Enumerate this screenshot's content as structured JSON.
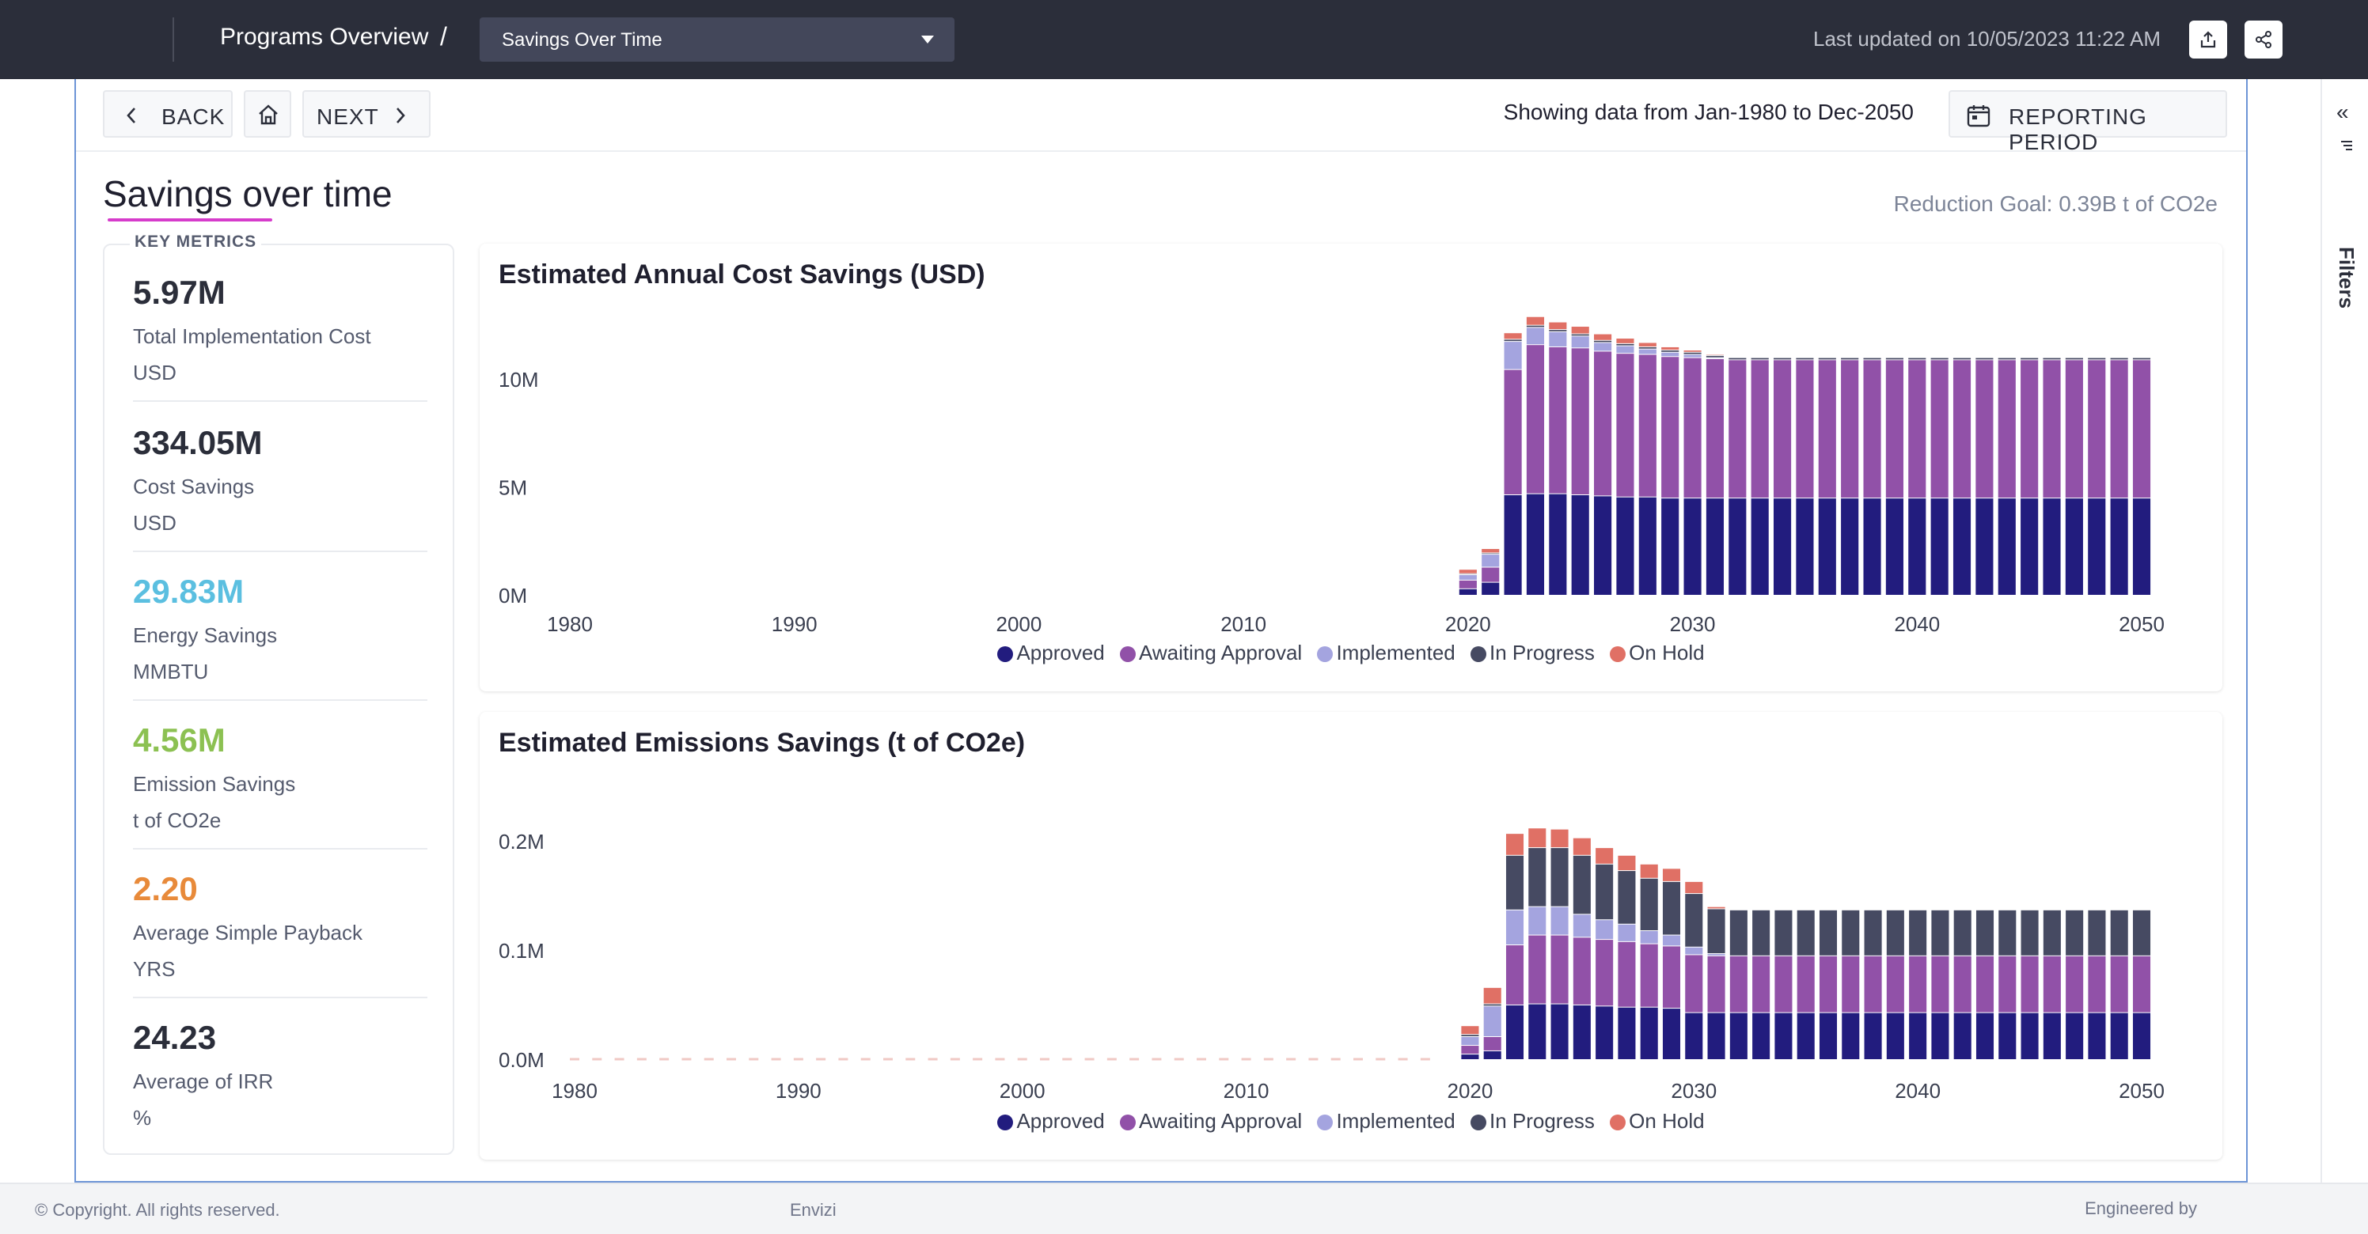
{
  "header": {
    "breadcrumb": "Programs Overview",
    "separator": "/",
    "view_select": "Savings Over Time",
    "last_updated": "Last updated on 10/05/2023 11:22 AM",
    "icons": [
      "export-icon",
      "share-icon"
    ]
  },
  "nav": {
    "back_label": "BACK",
    "next_label": "NEXT",
    "showing_text": "Showing data from Jan-1980 to Dec-2050",
    "reporting_period_label": "REPORTING PERIOD"
  },
  "page": {
    "title": "Savings over time",
    "reduction_goal": "Reduction Goal: 0.39B t of CO2e"
  },
  "key_metrics": {
    "heading": "KEY METRICS",
    "items": [
      {
        "value": "5.97M",
        "label": "Total Implementation Cost",
        "unit": "USD",
        "color": "#2b2e3a"
      },
      {
        "value": "334.05M",
        "label": "Cost Savings",
        "unit": "USD",
        "color": "#2b2e3a"
      },
      {
        "value": "29.83M",
        "label": "Energy Savings",
        "unit": "MMBTU",
        "color": "#5bbfe0"
      },
      {
        "value": "4.56M",
        "label": "Emission Savings",
        "unit": "t of CO2e",
        "color": "#8cc152"
      },
      {
        "value": "2.20",
        "label": "Average Simple Payback",
        "unit": "YRS",
        "color": "#e88a3a"
      },
      {
        "value": "24.23",
        "label": "Average of IRR",
        "unit": "%",
        "color": "#2b2e3a"
      }
    ]
  },
  "legend": {
    "approved": "Approved",
    "awaiting": "Awaiting Approval",
    "implemented": "Implemented",
    "in_progress": "In Progress",
    "on_hold": "On Hold"
  },
  "colors": {
    "approved": "#221c7e",
    "awaiting": "#9151a8",
    "implemented": "#a4a4df",
    "in_progress": "#464a62",
    "on_hold": "#e07065"
  },
  "chart_data": [
    {
      "type": "bar",
      "stacked": true,
      "title": "Estimated Annual Cost Savings (USD)",
      "xlabel": "",
      "ylabel": "",
      "xlim": [
        1980,
        2050
      ],
      "ylim": [
        0,
        13000000
      ],
      "x_ticks": [
        "1980",
        "1990",
        "2000",
        "2010",
        "2020",
        "2030",
        "2040",
        "2050"
      ],
      "y_ticks": [
        {
          "value": 0,
          "label": "0M"
        },
        {
          "value": 5000000,
          "label": "5M"
        },
        {
          "value": 10000000,
          "label": "10M"
        }
      ],
      "x": [
        2020,
        2021,
        2022,
        2023,
        2024,
        2025,
        2026,
        2027,
        2028,
        2029,
        2030,
        2031,
        2032,
        2033,
        2034,
        2035,
        2036,
        2037,
        2038,
        2039,
        2040,
        2041,
        2042,
        2043,
        2044,
        2045,
        2046,
        2047,
        2048,
        2049,
        2050
      ],
      "series": [
        {
          "name": "Approved",
          "values": [
            300000,
            600000,
            4650000,
            4700000,
            4700000,
            4650000,
            4600000,
            4550000,
            4550000,
            4500000,
            4500000,
            4500000,
            4500000,
            4500000,
            4500000,
            4500000,
            4500000,
            4500000,
            4500000,
            4500000,
            4500000,
            4500000,
            4500000,
            4500000,
            4500000,
            4500000,
            4500000,
            4500000,
            4500000,
            4500000,
            4500000
          ]
        },
        {
          "name": "Awaiting Approval",
          "values": [
            400000,
            700000,
            5800000,
            6900000,
            6800000,
            6800000,
            6700000,
            6650000,
            6600000,
            6550000,
            6500000,
            6450000,
            6400000,
            6400000,
            6400000,
            6400000,
            6400000,
            6400000,
            6400000,
            6400000,
            6400000,
            6400000,
            6400000,
            6400000,
            6400000,
            6400000,
            6400000,
            6400000,
            6400000,
            6400000,
            6400000
          ]
        },
        {
          "name": "Implemented",
          "values": [
            250000,
            600000,
            1300000,
            800000,
            700000,
            550000,
            400000,
            350000,
            250000,
            200000,
            150000,
            50000,
            0,
            0,
            0,
            0,
            0,
            0,
            0,
            0,
            0,
            0,
            0,
            0,
            0,
            0,
            0,
            0,
            0,
            0,
            0
          ]
        },
        {
          "name": "In Progress",
          "values": [
            50000,
            60000,
            100000,
            100000,
            100000,
            100000,
            100000,
            100000,
            100000,
            100000,
            100000,
            100000,
            100000,
            100000,
            100000,
            100000,
            100000,
            100000,
            100000,
            100000,
            100000,
            100000,
            100000,
            100000,
            100000,
            100000,
            100000,
            100000,
            100000,
            100000,
            100000
          ]
        },
        {
          "name": "On Hold",
          "values": [
            200000,
            200000,
            300000,
            400000,
            350000,
            350000,
            300000,
            250000,
            200000,
            150000,
            100000,
            50000,
            0,
            0,
            0,
            0,
            0,
            0,
            0,
            0,
            0,
            0,
            0,
            0,
            0,
            0,
            0,
            0,
            0,
            0,
            0
          ]
        }
      ]
    },
    {
      "type": "bar",
      "stacked": true,
      "title": "Estimated Emissions Savings (t of CO2e)",
      "xlabel": "",
      "ylabel": "",
      "xlim": [
        1980,
        2050
      ],
      "ylim": [
        0,
        0.21
      ],
      "x_ticks": [
        "1980",
        "1990",
        "2000",
        "2010",
        "2020",
        "2030",
        "2040",
        "2050"
      ],
      "y_ticks": [
        {
          "value": 0,
          "label": "0.0M"
        },
        {
          "value": 0.1,
          "label": "0.1M"
        },
        {
          "value": 0.2,
          "label": "0.2M"
        }
      ],
      "x": [
        2020,
        2021,
        2022,
        2023,
        2024,
        2025,
        2026,
        2027,
        2028,
        2029,
        2030,
        2031,
        2032,
        2033,
        2034,
        2035,
        2036,
        2037,
        2038,
        2039,
        2040,
        2041,
        2042,
        2043,
        2044,
        2045,
        2046,
        2047,
        2048,
        2049,
        2050
      ],
      "series": [
        {
          "name": "Approved",
          "values": [
            0.005,
            0.008,
            0.05,
            0.051,
            0.051,
            0.05,
            0.049,
            0.048,
            0.048,
            0.047,
            0.043,
            0.043,
            0.043,
            0.043,
            0.043,
            0.043,
            0.043,
            0.043,
            0.043,
            0.043,
            0.043,
            0.043,
            0.043,
            0.043,
            0.043,
            0.043,
            0.043,
            0.043,
            0.043,
            0.043,
            0.043
          ]
        },
        {
          "name": "Awaiting Approval",
          "values": [
            0.008,
            0.013,
            0.055,
            0.063,
            0.063,
            0.062,
            0.061,
            0.06,
            0.058,
            0.057,
            0.053,
            0.052,
            0.052,
            0.052,
            0.052,
            0.052,
            0.052,
            0.052,
            0.052,
            0.052,
            0.052,
            0.052,
            0.052,
            0.052,
            0.052,
            0.052,
            0.052,
            0.052,
            0.052,
            0.052,
            0.052
          ]
        },
        {
          "name": "Implemented",
          "values": [
            0.008,
            0.028,
            0.032,
            0.026,
            0.026,
            0.021,
            0.018,
            0.016,
            0.012,
            0.01,
            0.007,
            0.002,
            0.0,
            0.0,
            0.0,
            0.0,
            0.0,
            0.0,
            0.0,
            0.0,
            0.0,
            0.0,
            0.0,
            0.0,
            0.0,
            0.0,
            0.0,
            0.0,
            0.0,
            0.0,
            0.0
          ]
        },
        {
          "name": "In Progress",
          "values": [
            0.002,
            0.002,
            0.05,
            0.054,
            0.054,
            0.054,
            0.051,
            0.049,
            0.048,
            0.049,
            0.049,
            0.041,
            0.042,
            0.042,
            0.042,
            0.042,
            0.042,
            0.042,
            0.042,
            0.042,
            0.042,
            0.042,
            0.042,
            0.042,
            0.042,
            0.042,
            0.042,
            0.042,
            0.042,
            0.042,
            0.042
          ]
        },
        {
          "name": "On Hold",
          "values": [
            0.008,
            0.015,
            0.02,
            0.018,
            0.017,
            0.016,
            0.015,
            0.014,
            0.013,
            0.012,
            0.011,
            0.002,
            0.0,
            0.0,
            0.0,
            0.0,
            0.0,
            0.0,
            0.0,
            0.0,
            0.0,
            0.0,
            0.0,
            0.0,
            0.0,
            0.0,
            0.0,
            0.0,
            0.0,
            0.0,
            0.0
          ]
        }
      ]
    }
  ],
  "rail": {
    "collapse": "«",
    "filters_label": "Filters"
  },
  "footer": {
    "copyright": "© Copyright. All rights reserved.",
    "brand": "Envizi",
    "engineered": "Engineered by"
  }
}
